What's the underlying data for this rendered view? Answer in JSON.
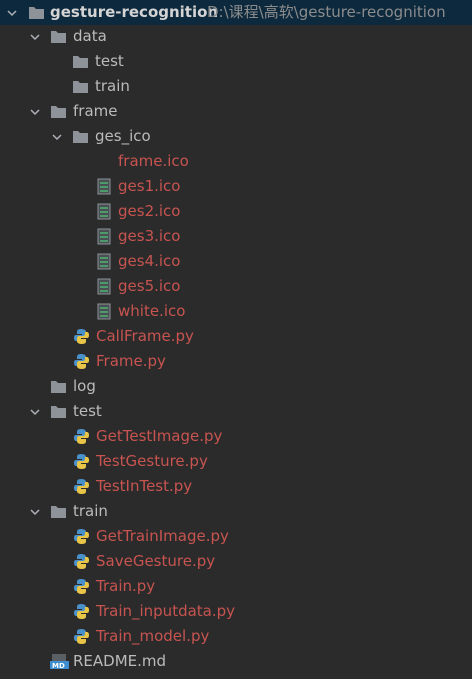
{
  "colors": {
    "background": "#2b2b2b",
    "text": "#bbbbbb",
    "modified_file": "#c75450",
    "folder": "#8e9399"
  },
  "root": {
    "name": "gesture-recognition",
    "path": "D:\\课程\\高软\\gesture-recognition"
  },
  "nodes": [
    {
      "name": "data",
      "icon": "folder-icon",
      "expanded": true
    },
    {
      "name": "test",
      "icon": "folder-icon"
    },
    {
      "name": "train",
      "icon": "folder-icon"
    },
    {
      "name": "frame",
      "icon": "folder-icon",
      "expanded": true
    },
    {
      "name": "ges_ico",
      "icon": "folder-icon",
      "expanded": true
    },
    {
      "name": "frame.ico",
      "icon": "none"
    },
    {
      "name": "ges1.ico",
      "icon": "image-file-icon"
    },
    {
      "name": "ges2.ico",
      "icon": "image-file-icon"
    },
    {
      "name": "ges3.ico",
      "icon": "image-file-icon"
    },
    {
      "name": "ges4.ico",
      "icon": "image-file-icon"
    },
    {
      "name": "ges5.ico",
      "icon": "image-file-icon"
    },
    {
      "name": "white.ico",
      "icon": "image-file-icon"
    },
    {
      "name": "CallFrame.py",
      "icon": "python-file-icon"
    },
    {
      "name": "Frame.py",
      "icon": "python-file-icon"
    },
    {
      "name": "log",
      "icon": "folder-icon"
    },
    {
      "name": "test",
      "icon": "folder-icon",
      "expanded": true
    },
    {
      "name": "GetTestImage.py",
      "icon": "python-file-icon"
    },
    {
      "name": "TestGesture.py",
      "icon": "python-file-icon"
    },
    {
      "name": "TestInTest.py",
      "icon": "python-file-icon"
    },
    {
      "name": "train",
      "icon": "folder-icon",
      "expanded": true
    },
    {
      "name": "GetTrainImage.py",
      "icon": "python-file-icon"
    },
    {
      "name": "SaveGesture.py",
      "icon": "python-file-icon"
    },
    {
      "name": "Train.py",
      "icon": "python-file-icon"
    },
    {
      "name": "Train_inputdata.py",
      "icon": "python-file-icon"
    },
    {
      "name": "Train_model.py",
      "icon": "python-file-icon"
    },
    {
      "name": "README.md",
      "icon": "markdown-file-icon"
    }
  ]
}
